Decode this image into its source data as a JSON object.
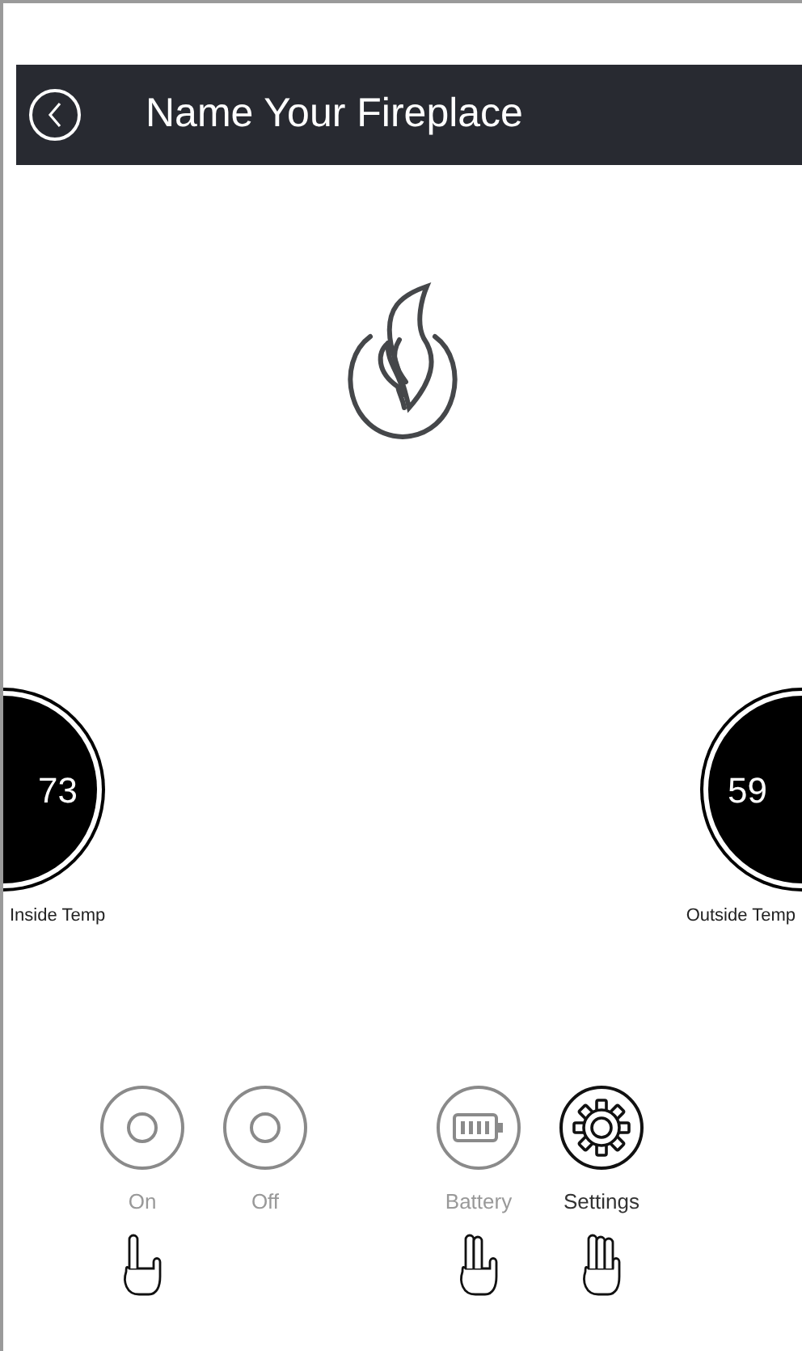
{
  "header": {
    "title": "Name Your Fireplace"
  },
  "temps": [
    {
      "value": "73",
      "label": "Inside Temp"
    },
    {
      "value": "59",
      "label": "Outside Temp"
    }
  ],
  "controls": [
    {
      "kind": "power",
      "label": "On",
      "highlighted": false,
      "hand": {
        "kind": "one_finger"
      }
    },
    {
      "kind": "power",
      "label": "Off",
      "highlighted": false
    },
    {
      "kind": "battery",
      "label": "Battery",
      "highlighted": false,
      "hand": {
        "kind": "two_finger"
      }
    },
    {
      "kind": "settings",
      "label": "Settings",
      "highlighted": true,
      "hand": {
        "kind": "three_finger"
      }
    }
  ]
}
